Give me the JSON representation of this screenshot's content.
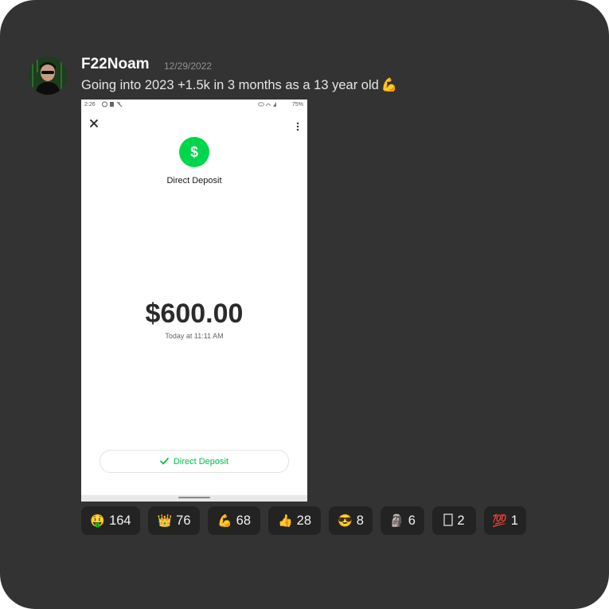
{
  "post": {
    "username": "F22Noam",
    "date": "12/29/2022",
    "message": "Going into 2023 +1.5k in 3 months as a 13 year old"
  },
  "screenshot": {
    "status_time": "2:26",
    "battery": "75%",
    "title": "Direct Deposit",
    "dollar_symbol": "$",
    "amount": "$600.00",
    "time": "Today at 11:11 AM",
    "button_label": "Direct Deposit",
    "accent_color": "#00d64b"
  },
  "reactions": [
    {
      "emoji": "🤑",
      "icon": "money-mouth-emoji",
      "count": "164"
    },
    {
      "emoji": "👑",
      "icon": "crown-emoji",
      "count": "76"
    },
    {
      "emoji": "💪",
      "icon": "flexed-biceps-emoji",
      "count": "68"
    },
    {
      "emoji": "👍",
      "icon": "thumbs-up-emoji",
      "count": "28"
    },
    {
      "emoji": "😎",
      "icon": "sunglasses-face-emoji",
      "count": "8"
    },
    {
      "emoji": "🗿",
      "icon": "moai-emoji",
      "count": "6"
    },
    {
      "emoji": "",
      "icon": "unknown-glyph-emoji",
      "count": "2"
    },
    {
      "emoji": "💯",
      "icon": "hundred-points-emoji",
      "count": "1"
    }
  ]
}
